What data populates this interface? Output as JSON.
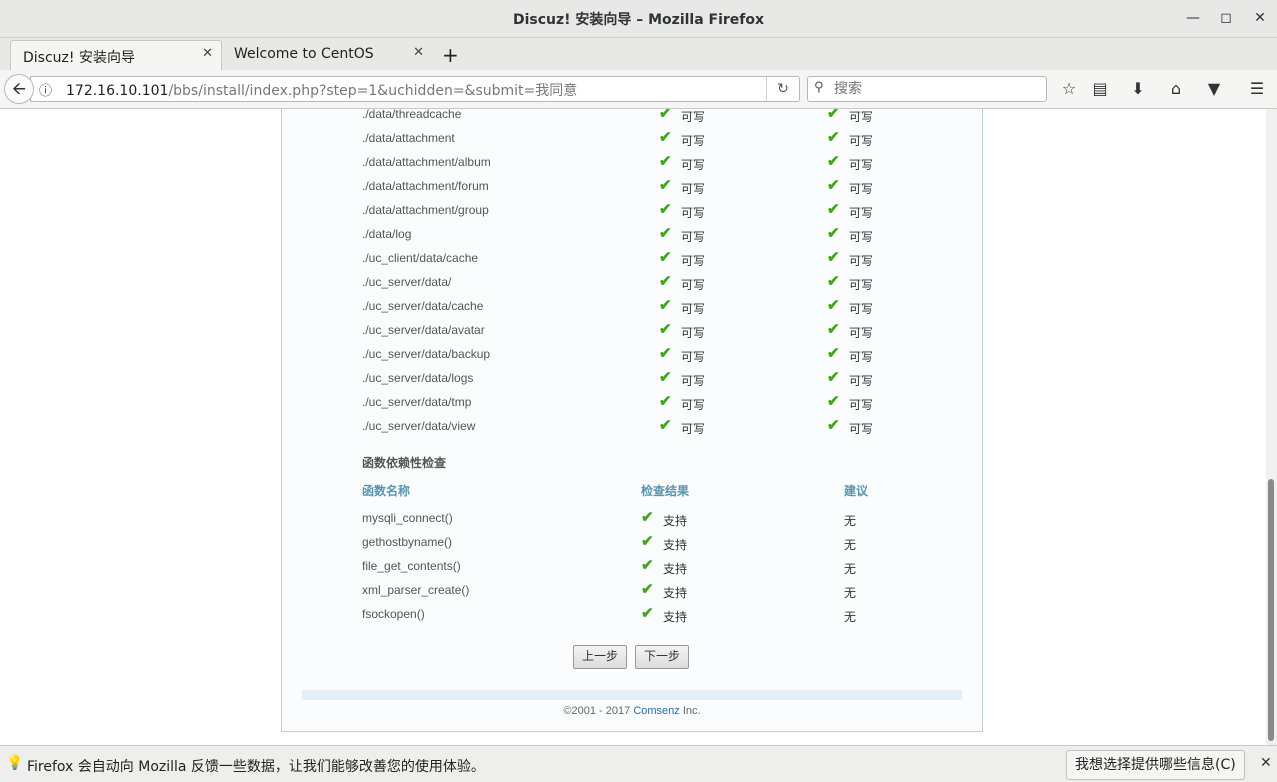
{
  "window": {
    "title": "Discuz! 安装向导  –  Mozilla Firefox"
  },
  "tabs": [
    {
      "label": "Discuz! 安装向导"
    },
    {
      "label": "Welcome to CentOS"
    }
  ],
  "nav": {
    "url_host": "172.16.10.101",
    "url_path": "/bbs/install/index.php?step=1&uchidden=&submit=我同意",
    "search_placeholder": "搜索"
  },
  "directories": {
    "status_label": "可写",
    "items": [
      "./data/threadcache",
      "./data/attachment",
      "./data/attachment/album",
      "./data/attachment/forum",
      "./data/attachment/group",
      "./data/log",
      "./uc_client/data/cache",
      "./uc_server/data/",
      "./uc_server/data/cache",
      "./uc_server/data/avatar",
      "./uc_server/data/backup",
      "./uc_server/data/logs",
      "./uc_server/data/tmp",
      "./uc_server/data/view"
    ]
  },
  "functions": {
    "section_title": "函数依赖性检查",
    "headers": {
      "name": "函数名称",
      "result": "检查结果",
      "suggestion": "建议"
    },
    "items": [
      {
        "name": "mysqli_connect()",
        "result": "支持",
        "suggestion": "无"
      },
      {
        "name": "gethostbyname()",
        "result": "支持",
        "suggestion": "无"
      },
      {
        "name": "file_get_contents()",
        "result": "支持",
        "suggestion": "无"
      },
      {
        "name": "xml_parser_create()",
        "result": "支持",
        "suggestion": "无"
      },
      {
        "name": "fsockopen()",
        "result": "支持",
        "suggestion": "无"
      }
    ]
  },
  "buttons": {
    "prev": "上一步",
    "next": "下一步"
  },
  "footer": {
    "prefix": "©2001 - 2017 ",
    "brand": "Comsenz",
    "suffix": " Inc."
  },
  "notification": {
    "message": "Firefox 会自动向 Mozilla 反馈一些数据，让我们能够改善您的使用体验。",
    "action": "我想选择提供哪些信息(C)"
  },
  "colors": {
    "check": "#3fa51c",
    "header_blue": "#5a95ad",
    "border": "#b7d1df"
  }
}
